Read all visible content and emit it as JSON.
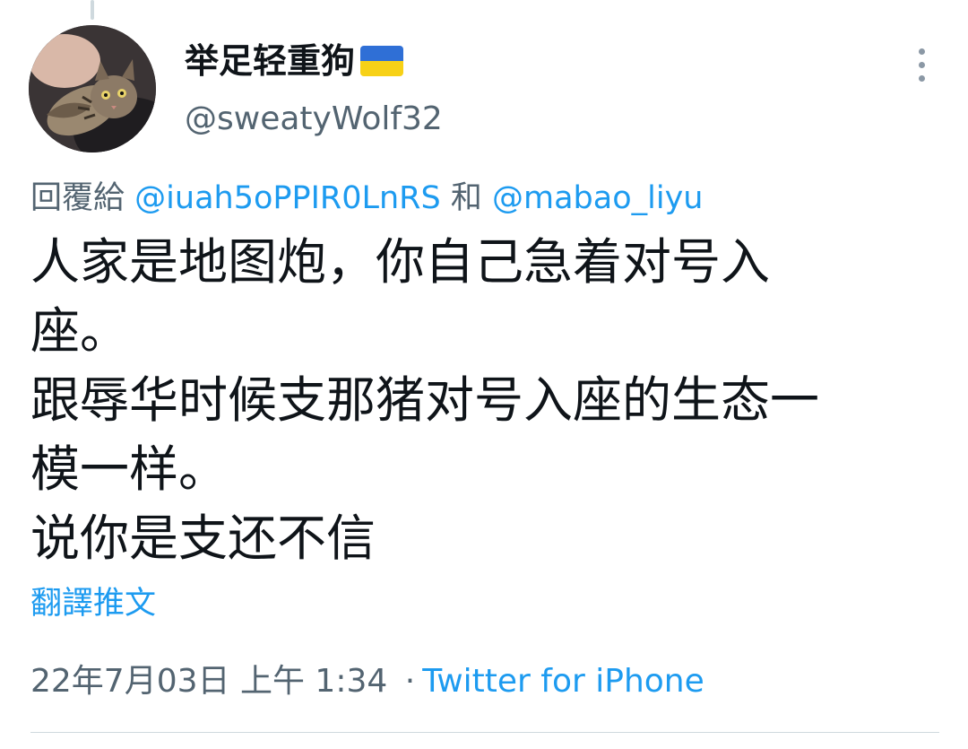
{
  "author": {
    "display_name": "举足轻重狗",
    "flag_colors": {
      "top": "#2f6fd6",
      "bottom": "#f7d117"
    },
    "handle": "@sweatyWolf32"
  },
  "reply": {
    "prefix": "回覆給",
    "mention1": "@iuah5oPPIR0LnRS",
    "joiner": "和",
    "mention2": "@mabao_liyu"
  },
  "tweet": {
    "lines": [
      "人家是地图炮，你自己急着对号入",
      "座。",
      "跟辱华时候支那猪对号入座的生态一",
      "模一样。",
      "说你是支还不信"
    ]
  },
  "translate_label": "翻譯推文",
  "meta": {
    "date": "22年7月03日",
    "time": "上午 1:34",
    "separator": "·",
    "source": "Twitter for iPhone"
  },
  "colors": {
    "accent": "#1d9bf0",
    "secondary_text": "#536471"
  }
}
